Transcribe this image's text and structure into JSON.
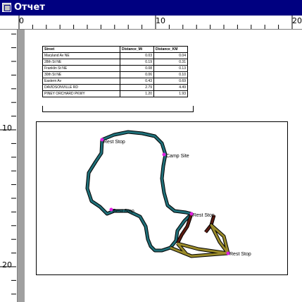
{
  "window": {
    "title": "Отчет"
  },
  "ruler": {
    "top_labels": [
      "0",
      "10",
      "20"
    ],
    "left_labels": [
      "10",
      "20"
    ]
  },
  "report_table": {
    "headers": [
      "Street",
      "Distance_Mi",
      "Distance_KM"
    ],
    "rows": [
      [
        "Maryland Av NE",
        "0.03",
        "0.04"
      ],
      [
        "28th St NE",
        "0.19",
        "0.31"
      ],
      [
        "Franklin St NE",
        "0.08",
        "0.13"
      ],
      [
        "30th St NE",
        "0.06",
        "0.10"
      ],
      [
        "Eastern Av",
        "0.43",
        "0.69"
      ],
      [
        "DAVIDSONVILLE RD",
        "2.79",
        "4.49"
      ],
      [
        "PINEY ORCHARD PKWY",
        "1.20",
        "1.93"
      ]
    ]
  },
  "map": {
    "labels": [
      "Rest Stop",
      "Camp Site",
      "Rest Stop",
      "Rest Stop",
      "Rest Stop"
    ],
    "colors": {
      "route_teal": "#1f6f78",
      "route_brown": "#5a1a10",
      "route_olive": "#9a8a2a",
      "stop_marker": "#e020e0"
    }
  }
}
